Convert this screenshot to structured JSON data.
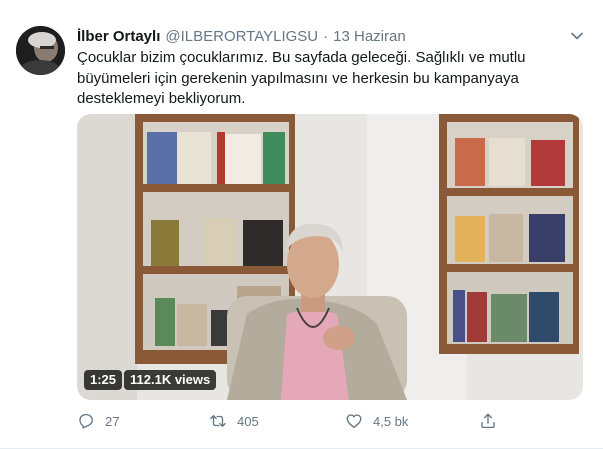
{
  "tweet": {
    "author_name": "İlber Ortaylı",
    "handle": "@ILBERORTAYLIGSU",
    "separator": "·",
    "date": "13 Haziran",
    "text": "Çocuklar bizim çocuklarımız. Bu sayfada geleceği. Sağlıklı ve mutlu büyümeleri için gerekenin yapılmasını ve herkesin bu kampanyaya desteklemeyi bekliyorum."
  },
  "video": {
    "duration": "1:25",
    "views": "112.1K views"
  },
  "actions": {
    "reply_count": "27",
    "retweet_count": "405",
    "like_count": "4,5 bk"
  },
  "icons": {
    "more": "chevron-down-icon",
    "reply": "reply-icon",
    "retweet": "retweet-icon",
    "like": "heart-icon",
    "share": "share-icon"
  },
  "colors": {
    "text": "#14171a",
    "secondary": "#657786",
    "divider": "#e6ecf0"
  }
}
